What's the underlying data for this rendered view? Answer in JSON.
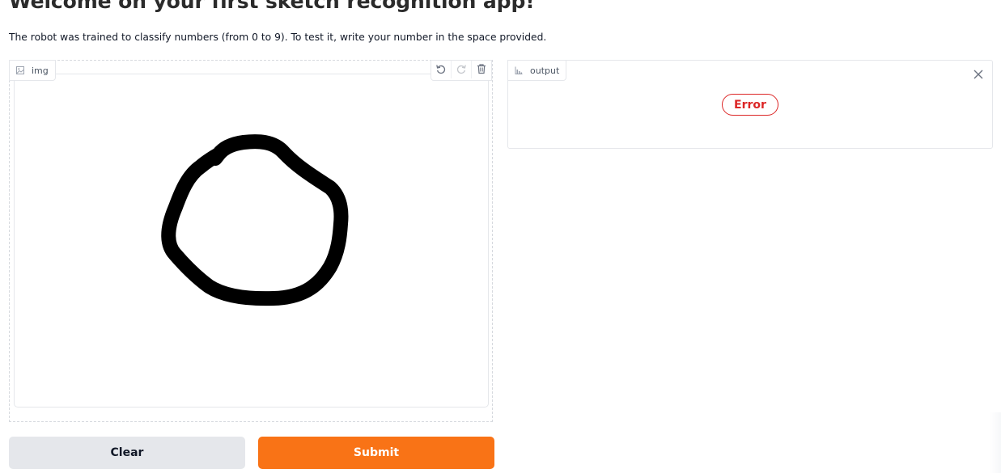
{
  "header": {
    "title": "Welcome on your first sketch recognition app!",
    "description": "The robot was trained to classify numbers (from 0 to 9). To test it, write your number in the space provided."
  },
  "input": {
    "label": "img",
    "label_icon": "image-icon",
    "toolbar": [
      {
        "name": "undo",
        "icon": "undo-icon"
      },
      {
        "name": "redo",
        "icon": "redo-icon"
      },
      {
        "name": "clear",
        "icon": "trash-icon"
      }
    ]
  },
  "output": {
    "label": "output",
    "label_icon": "chart-icon",
    "status": "Error",
    "status_color": "#dc2626",
    "close_icon": "close-icon"
  },
  "actions": {
    "clear_label": "Clear",
    "submit_label": "Submit",
    "submit_color": "#f97316"
  }
}
